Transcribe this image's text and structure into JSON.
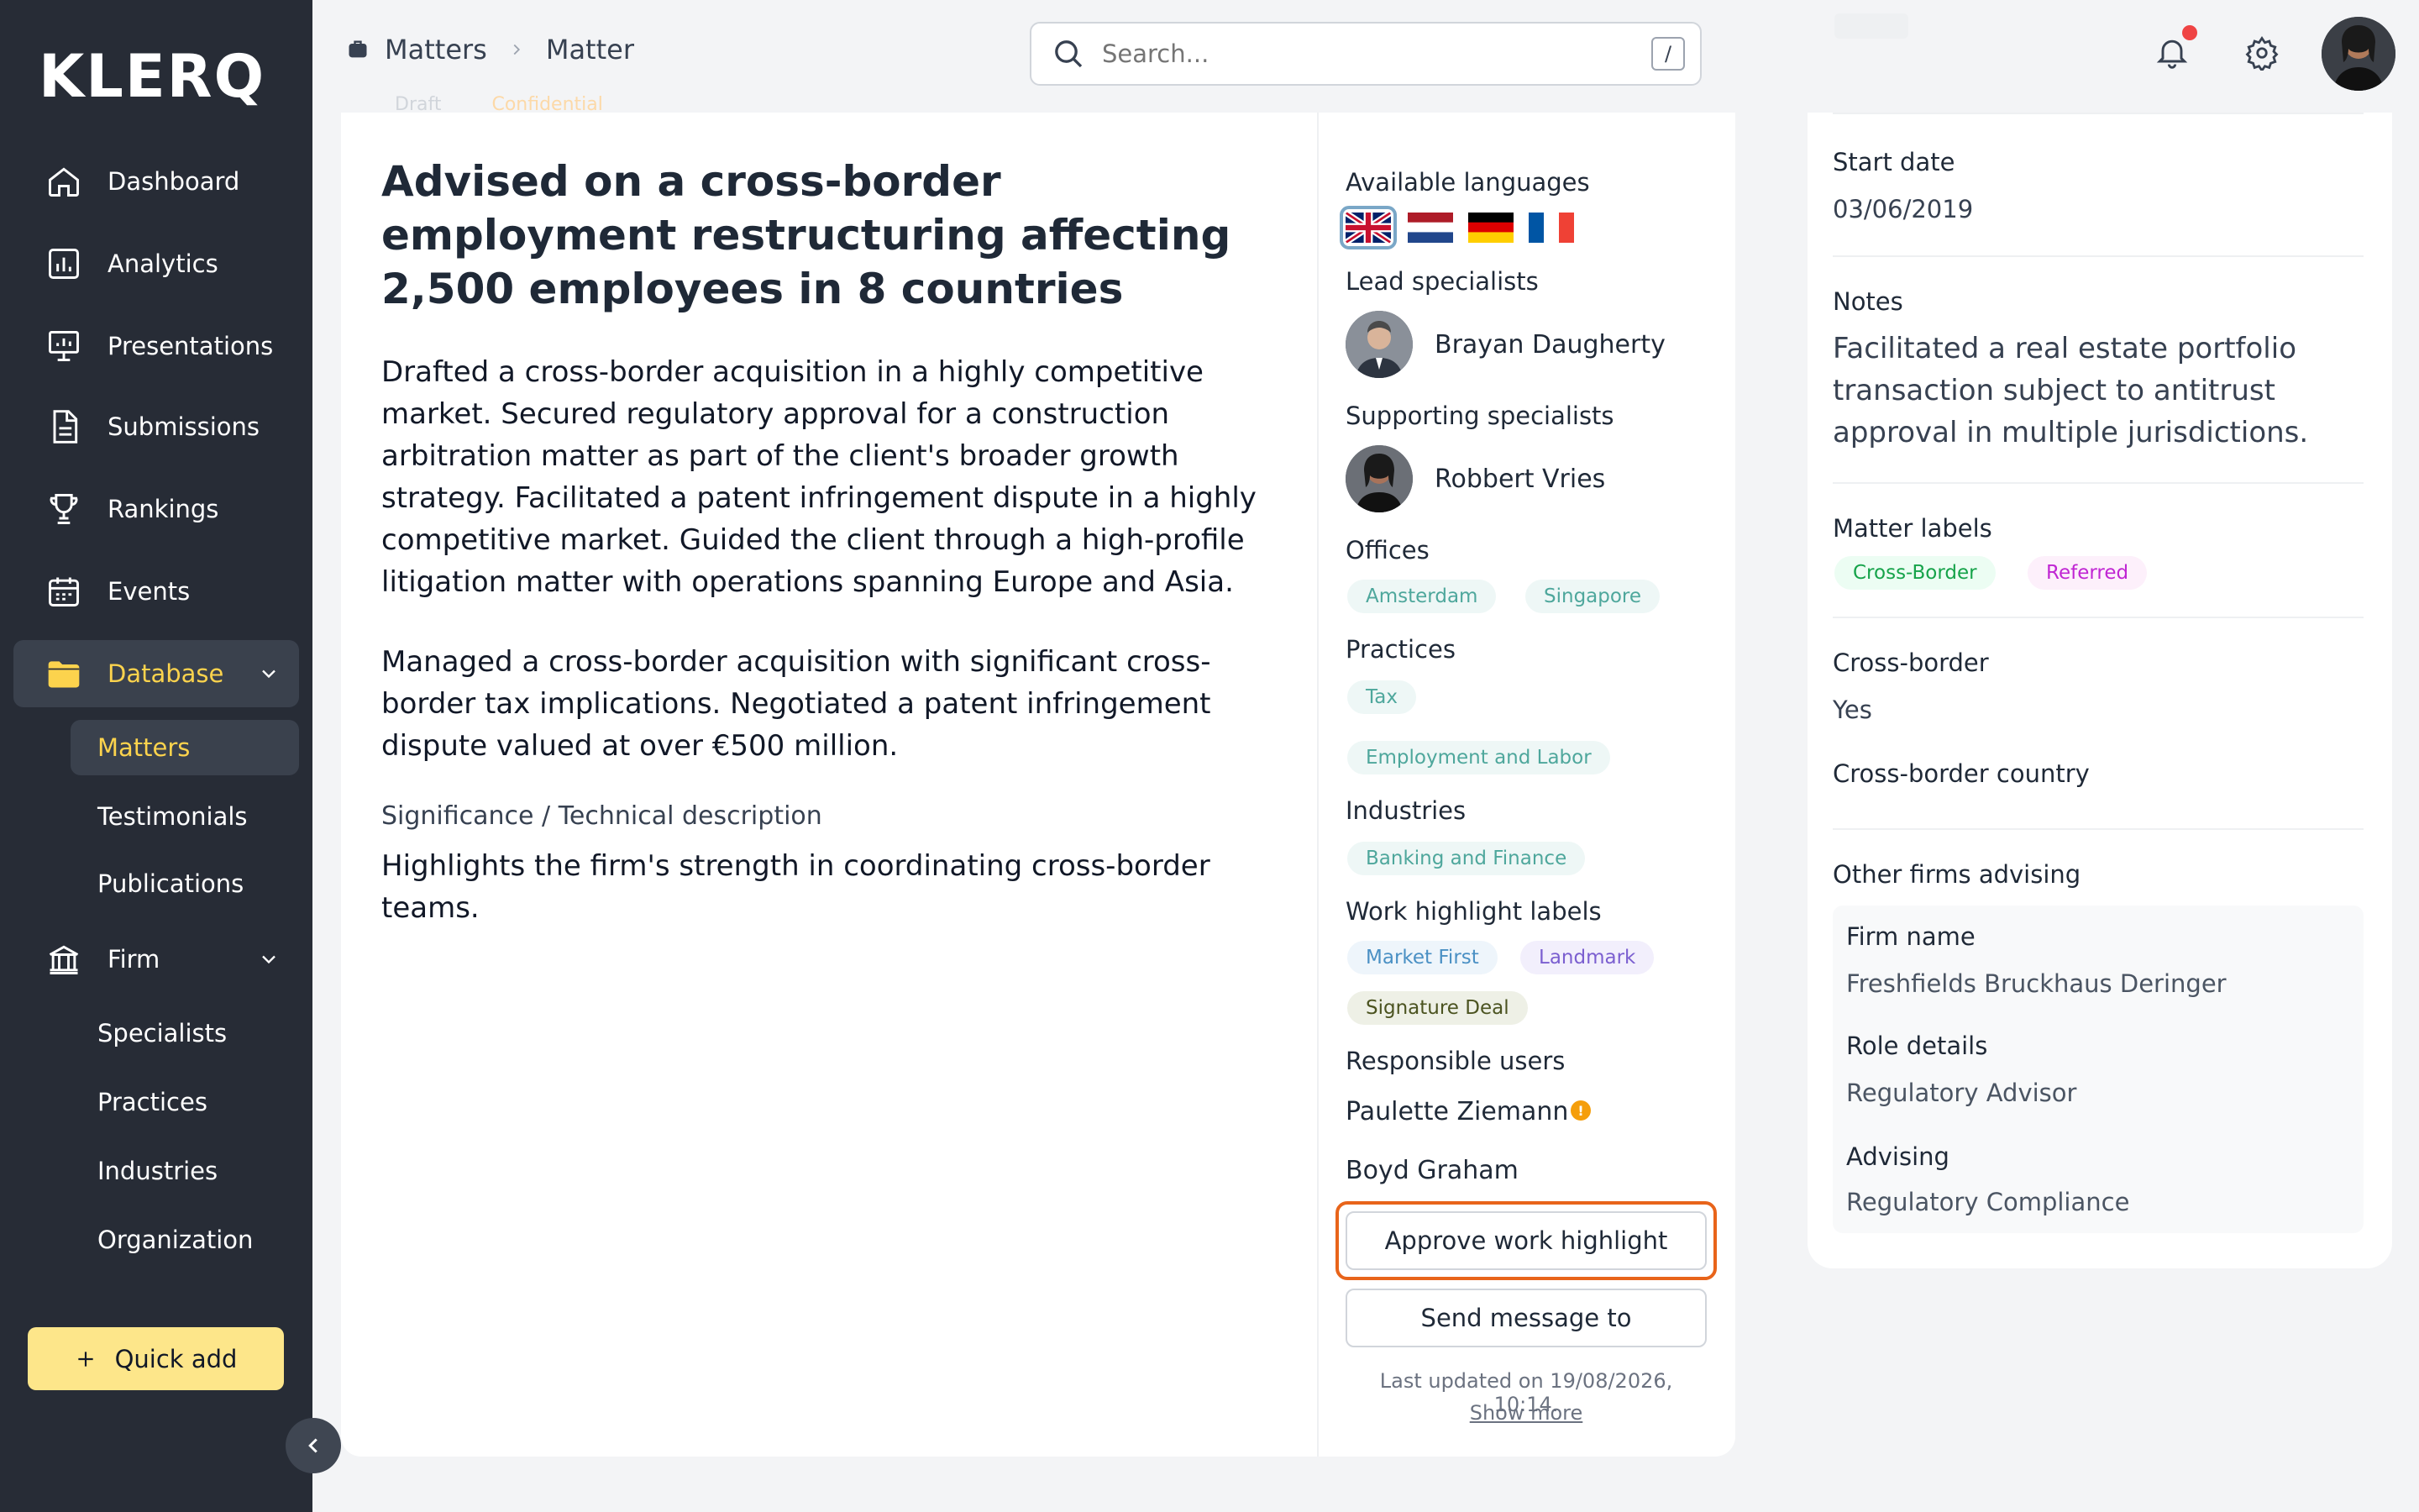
{
  "sidebar": {
    "logo": "KLERQ",
    "items": [
      {
        "label": "Dashboard"
      },
      {
        "label": "Analytics"
      },
      {
        "label": "Presentations"
      },
      {
        "label": "Submissions"
      },
      {
        "label": "Rankings"
      },
      {
        "label": "Events"
      },
      {
        "label": "Database"
      }
    ],
    "database_sub": [
      {
        "label": "Matters"
      },
      {
        "label": "Testimonials"
      },
      {
        "label": "Publications"
      }
    ],
    "firm_label": "Firm",
    "firm_sub": [
      {
        "label": "Specialists"
      },
      {
        "label": "Practices"
      },
      {
        "label": "Industries"
      },
      {
        "label": "Organization"
      }
    ],
    "quick_add": "Quick add"
  },
  "topbar": {
    "breadcrumb": [
      "Matters",
      "Matter"
    ],
    "search_placeholder": "Search...",
    "search_shortcut": "/"
  },
  "status_tags": [
    "Draft",
    "Confidential"
  ],
  "matter": {
    "title": "Advised on a cross-border employment restructuring affecting 2,500 employees in 8 countries",
    "paragraph1": "Drafted a cross-border acquisition in a highly competitive market. Secured regulatory approval for a construction arbitration matter as part of the client's broader growth strategy. Facilitated a patent infringement dispute in a highly competitive market. Guided the client through a high-profile litigation matter with operations spanning Europe and Asia.",
    "paragraph2": "Managed a cross-border acquisition with significant cross-border tax implications. Negotiated a patent infringement dispute valued at over €500 million.",
    "significance_label": "Significance / Technical description",
    "significance": "Highlights the firm's strength in coordinating cross-border teams."
  },
  "details": {
    "languages_label": "Available languages",
    "languages": [
      "English",
      "Dutch",
      "German",
      "French"
    ],
    "lead_label": "Lead specialists",
    "lead": "Brayan Daugherty",
    "supporting_label": "Supporting specialists",
    "supporting": "Robbert Vries",
    "offices_label": "Offices",
    "offices": [
      "Amsterdam",
      "Singapore"
    ],
    "practices_label": "Practices",
    "practices": [
      "Tax",
      "Employment and Labor"
    ],
    "industries_label": "Industries",
    "industries": [
      "Banking and Finance"
    ],
    "highlight_label": "Work highlight labels",
    "highlights": [
      "Market First",
      "Landmark",
      "Signature Deal"
    ],
    "responsible_label": "Responsible users",
    "responsible": [
      "Paulette Ziemann",
      "Boyd Graham"
    ],
    "approve_button": "Approve work highlight",
    "message_button": "Send message to",
    "last_updated": "Last updated on 19/08/2026, 10:14.",
    "show_more": "Show more"
  },
  "right": {
    "start_date_label": "Start date",
    "start_date": "03/06/2019",
    "notes_label": "Notes",
    "notes": "Facilitated a real estate portfolio transaction subject to antitrust approval in multiple jurisdictions.",
    "matter_labels_label": "Matter labels",
    "matter_labels": [
      "Cross-Border",
      "Referred"
    ],
    "cross_border_label": "Cross-border",
    "cross_border": "Yes",
    "cross_border_country_label": "Cross-border country",
    "other_firms_label": "Other firms advising",
    "firm_name_label": "Firm name",
    "firm_name": "Freshfields Bruckhaus Deringer",
    "role_label": "Role details",
    "role": "Regulatory Advisor",
    "advising_label": "Advising",
    "advising": "Regulatory Compliance"
  },
  "colors": {
    "sidebar_bg": "#272c36",
    "accent_yellow": "#fcd34d",
    "quick_add_bg": "#fde68a",
    "focus_ring": "#e8641a"
  }
}
